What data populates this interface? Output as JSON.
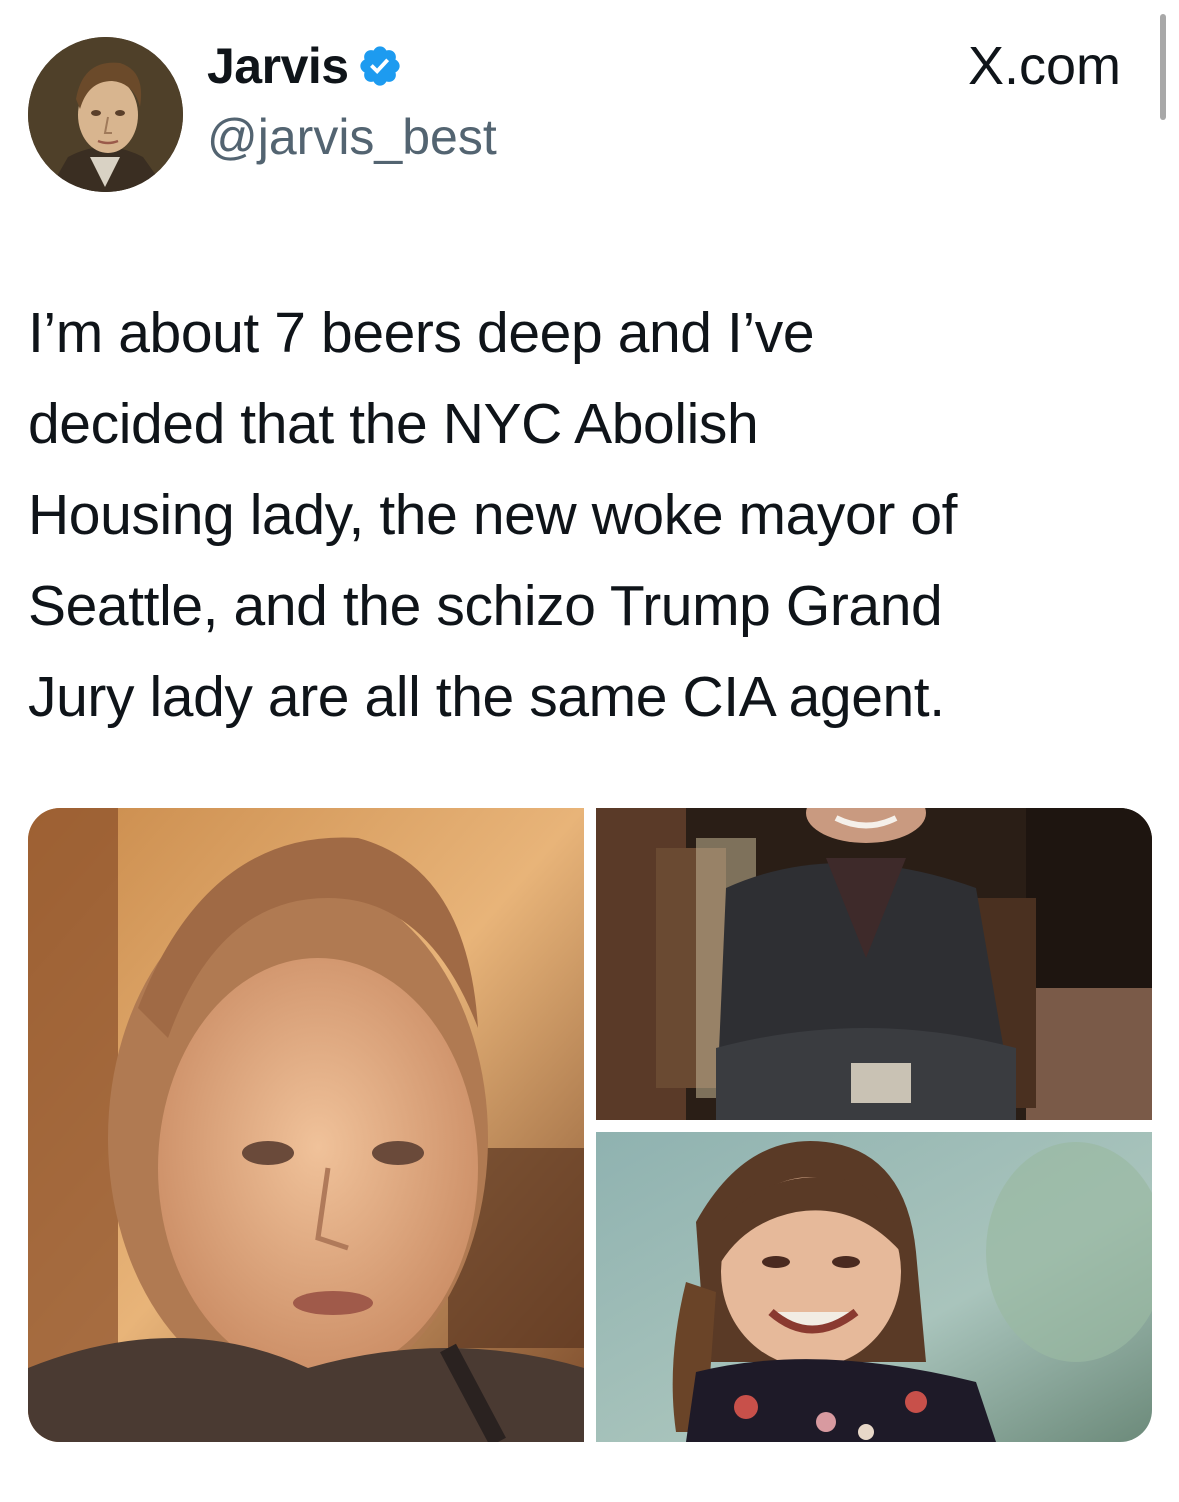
{
  "author": {
    "display_name": "Jarvis",
    "handle": "@jarvis_best",
    "verified": true,
    "avatar_icon": "portrait-painting-avatar"
  },
  "brand": {
    "label": "X.com"
  },
  "tweet": {
    "text": "I’m about 7 beers deep and I’ve\ndecided that the NYC Abolish\nHousing lady, the new woke mayor of\nSeattle, and the schizo Trump Grand\nJury lady are all the same CIA agent."
  },
  "media": {
    "images": [
      {
        "icon": "woman-selfie-photo"
      },
      {
        "icon": "person-seated-in-chair-photo"
      },
      {
        "icon": "woman-smiling-photo"
      }
    ]
  },
  "colors": {
    "text": "#0f1419",
    "secondary_text": "#536471",
    "verified_blue": "#1d9bf0"
  }
}
